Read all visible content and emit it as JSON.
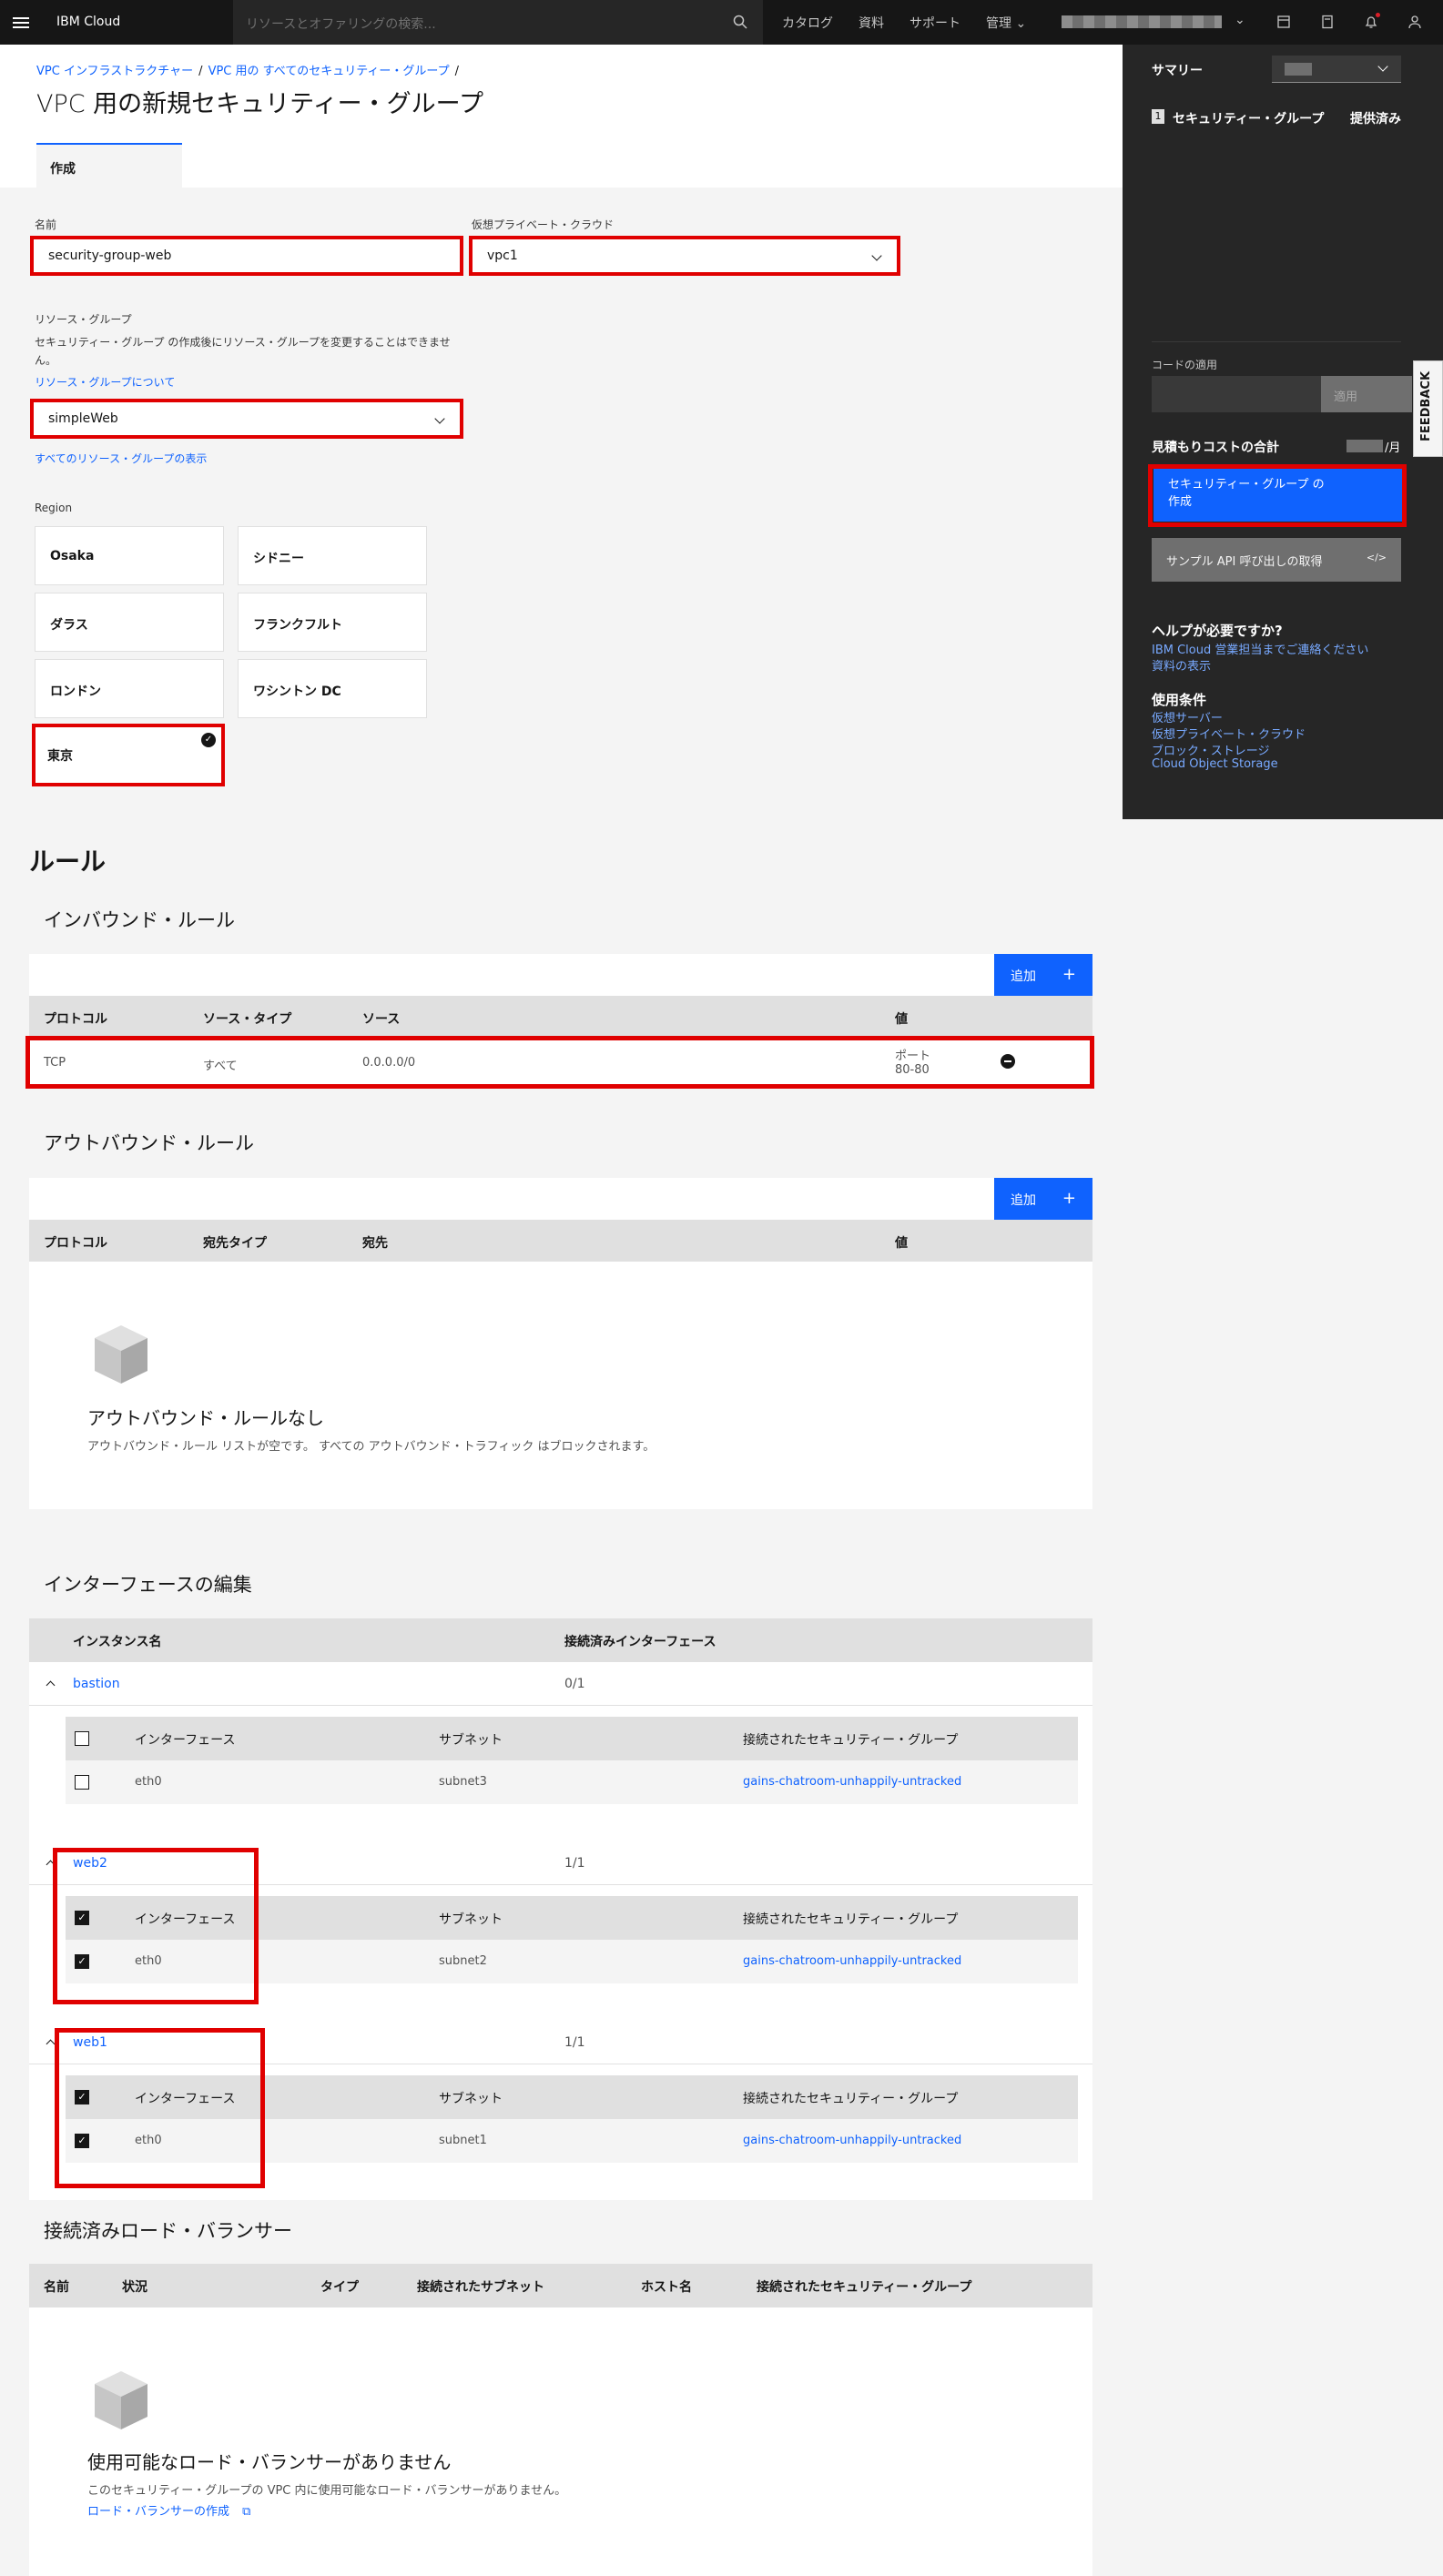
{
  "topbar": {
    "brand": "IBM Cloud",
    "search_placeholder": "リソースとオファリングの検索...",
    "nav": [
      "カタログ",
      "資料",
      "サポート",
      "管理"
    ]
  },
  "breadcrumb": {
    "items": [
      "VPC インフラストラクチャー",
      "VPC 用の すべてのセキュリティー・グループ"
    ],
    "sep": "/"
  },
  "page": {
    "title": "VPC 用の新規セキュリティー・グループ",
    "tab": "作成"
  },
  "form": {
    "name_label": "名前",
    "name_value": "security-group-web",
    "vpc_label": "仮想プライベート・クラウド",
    "vpc_value": "vpc1",
    "rg_label": "リソース・グループ",
    "rg_help": "セキュリティー・グループ の作成後にリソース・グループを変更することはできません。",
    "rg_link": "リソース・グループについて",
    "rg_value": "simpleWeb",
    "rg_all_link": "すべてのリソース・グループの表示",
    "region_label": "Region",
    "regions": [
      "Osaka",
      "シドニー",
      "ダラス",
      "フランクフルト",
      "ロンドン",
      "ワシントン DC",
      "東京"
    ]
  },
  "rules": {
    "title": "ルール",
    "inbound_title": "インバウンド・ルール",
    "add_label": "追加",
    "inbound_headers": [
      "プロトコル",
      "ソース・タイプ",
      "ソース",
      "値"
    ],
    "inbound_row": {
      "protocol": "TCP",
      "type": "すべて",
      "source": "0.0.0.0/0",
      "value1": "ポート",
      "value2": "80-80"
    },
    "outbound_title": "アウトバウンド・ルール",
    "outbound_headers": [
      "プロトコル",
      "宛先タイプ",
      "宛先",
      "値"
    ],
    "outbound_empty_title": "アウトバウンド・ルールなし",
    "outbound_empty_desc": "アウトバウンド・ルール リストが空です。 すべての アウトバウンド・トラフィック はブロックされます。"
  },
  "interfaces": {
    "title": "インターフェースの編集",
    "headers": [
      "インスタンス名",
      "接続済みインターフェース"
    ],
    "sub_headers": [
      "インターフェース",
      "サブネット",
      "接続されたセキュリティー・グループ"
    ],
    "groups": [
      {
        "name": "bastion",
        "count": "0/1",
        "iface": "eth0",
        "subnet": "subnet3",
        "sg": "gains-chatroom-unhappily-untracked"
      },
      {
        "name": "web2",
        "count": "1/1",
        "iface": "eth0",
        "subnet": "subnet2",
        "sg": "gains-chatroom-unhappily-untracked"
      },
      {
        "name": "web1",
        "count": "1/1",
        "iface": "eth0",
        "subnet": "subnet1",
        "sg": "gains-chatroom-unhappily-untracked"
      }
    ]
  },
  "lb": {
    "title": "接続済みロード・バランサー",
    "headers": [
      "名前",
      "状況",
      "タイプ",
      "接続されたサブネット",
      "ホスト名",
      "接続されたセキュリティー・グループ"
    ],
    "empty_title": "使用可能なロード・バランサーがありません",
    "empty_desc": "このセキュリティー・グループの VPC 内に使用可能なロード・バランサーがありません。",
    "create_link": "ロード・バランサーの作成"
  },
  "sidebar": {
    "summary": "サマリー",
    "item_num": "1",
    "item_label": "セキュリティー・グループ",
    "item_status": "提供済み",
    "code_label": "コードの適用",
    "apply": "適用",
    "cost_label": "見積もりコストの合計",
    "cost_unit": "/月",
    "create_btn_1": "セキュリティー・グループ の",
    "create_btn_2": "作成",
    "api_btn": "サンプル API 呼び出しの取得",
    "api_icon": "</>",
    "help_title": "ヘルプが必要ですか?",
    "help_links": [
      "IBM Cloud 営業担当までご連絡ください",
      "資料の表示"
    ],
    "terms_title": "使用条件",
    "terms_links": [
      "仮想サーバー",
      "仮想プライベート・クラウド",
      "ブロック・ストレージ",
      "Cloud Object Storage"
    ],
    "feedback": "FEEDBACK"
  }
}
